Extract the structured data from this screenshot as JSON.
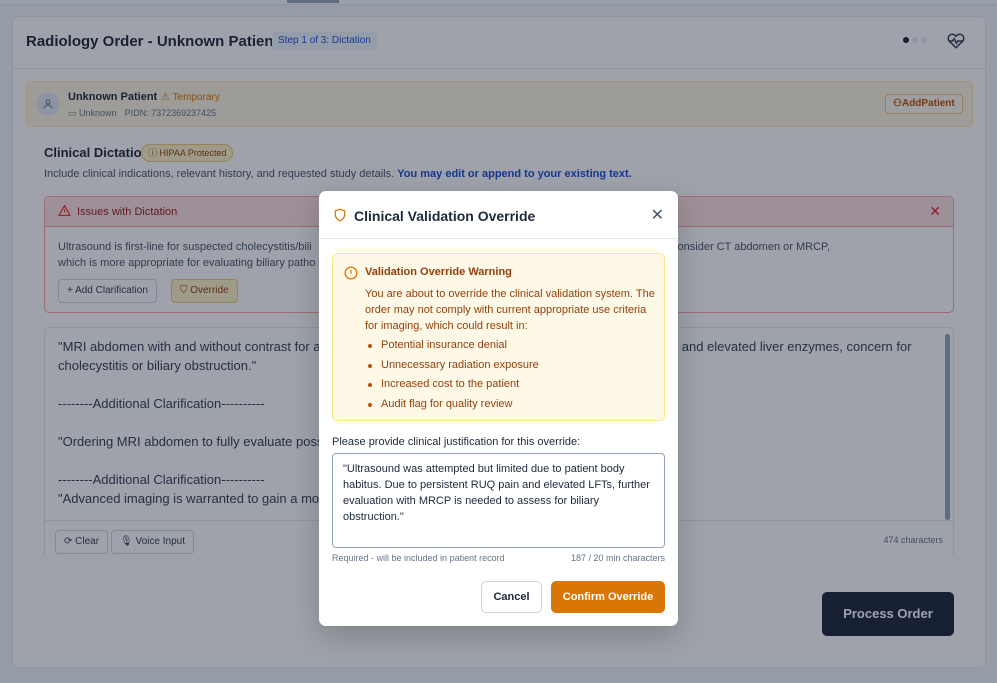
{
  "header": {
    "title": "Radiology Order - Unknown Patient",
    "step_badge": "Step 1 of 3: Dictation"
  },
  "patient": {
    "name": "Unknown Patient",
    "status": "Temporary",
    "dob": "Unknown",
    "pidn_label": "PIDN:",
    "pidn": "7372369237425",
    "add_button": "AddPatient"
  },
  "dictation": {
    "title": "Clinical Dictation",
    "badge": "HIPAA Protected",
    "description": "Include clinical indications, relevant history, and requested study details.",
    "description_link": "You may edit or append to your existing text.",
    "issues": {
      "title": "Issues with Dictation",
      "body_start": "Ultrasound is first-line for suspected cholecystitis/bili",
      "body_end": "nd is inconclusive, consider CT abdomen or MRCP,",
      "body_line2": "which is more appropriate for evaluating biliary patho",
      "add_clarification": "Add Clarification",
      "override": "Override"
    },
    "editor_text": "\"MRI abdomen with and without contrast for a                                                                                                    and elevated liver enzymes, concern for\ncholecystitis or biliary obstruction.\"\n\n--------Additional Clarification----------\n\n\"Ordering MRI abdomen to fully evaluate poss\n\n--------Additional Clarification----------\n\"Advanced imaging is warranted to gain a mor",
    "clear": "Clear",
    "voice_input": "Voice Input",
    "char_count": "474 characters",
    "process_order": "Process Order"
  },
  "modal": {
    "title": "Clinical Validation Override",
    "warning_title": "Validation Override Warning",
    "warning_text": "You are about to override the clinical validation system. The order may not comply with current appropriate use criteria for imaging, which could result in:",
    "risks": [
      "Potential insurance denial",
      "Unnecessary radiation exposure",
      "Increased cost to the patient",
      "Audit flag for quality review"
    ],
    "justification_label": "Please provide clinical justification for this override:",
    "justification_value": "\"Ultrasound was attempted but limited due to patient body habitus. Due to persistent RUQ pain and elevated LFTs, further evaluation with MRCP is needed to assess for biliary obstruction.\"",
    "hint": "Required - will be included in patient record",
    "count": "187 / 20 min characters",
    "cancel": "Cancel",
    "confirm": "Confirm Override"
  },
  "colors": {
    "accent": "#d97706",
    "primary_dark": "#1e293b",
    "error": "#dc2626",
    "link": "#1d4ed8"
  },
  "icons": [
    "user-icon",
    "warning-triangle-icon",
    "calendar-icon",
    "user-plus-icon",
    "info-circle-icon",
    "shield-icon",
    "close-icon",
    "plus-icon",
    "refresh-icon",
    "mic-icon",
    "heart-pulse-icon",
    "alert-circle-icon"
  ]
}
